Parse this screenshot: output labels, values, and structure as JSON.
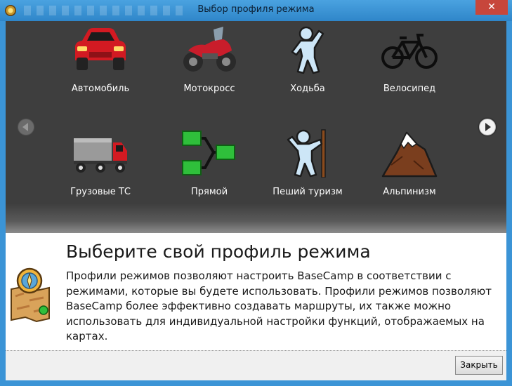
{
  "window": {
    "title": "Выбор профиля режима",
    "close_glyph": "✕"
  },
  "gallery": {
    "profiles": [
      {
        "label": "Автомобиль",
        "icon": "car-icon"
      },
      {
        "label": "Мотокросс",
        "icon": "motorcycle-icon"
      },
      {
        "label": "Ходьба",
        "icon": "walking-icon"
      },
      {
        "label": "Велосипед",
        "icon": "bicycle-icon"
      },
      {
        "label": "Грузовые ТС",
        "icon": "truck-icon"
      },
      {
        "label": "Прямой",
        "icon": "direct-route-icon"
      },
      {
        "label": "Пеший туризм",
        "icon": "hiking-icon"
      },
      {
        "label": "Альпинизм",
        "icon": "mountain-icon"
      }
    ],
    "prev_icon": "arrow-left-icon",
    "next_icon": "arrow-right-icon"
  },
  "info": {
    "title": "Выберите свой профиль режима",
    "description": "Профили режимов позволяют настроить BaseCamp в соответствии с режимами, которые вы будете использовать. Профили режимов позволяют BaseCamp более эффективно создавать маршруты, их также можно использовать для индивидуальной настройки функций, отображаемых на картах."
  },
  "footer": {
    "close_label": "Закрыть"
  },
  "colors": {
    "title_bar": "#3b94d6",
    "gallery_background": "#3e3e3e",
    "close_button": "#c7463b"
  }
}
